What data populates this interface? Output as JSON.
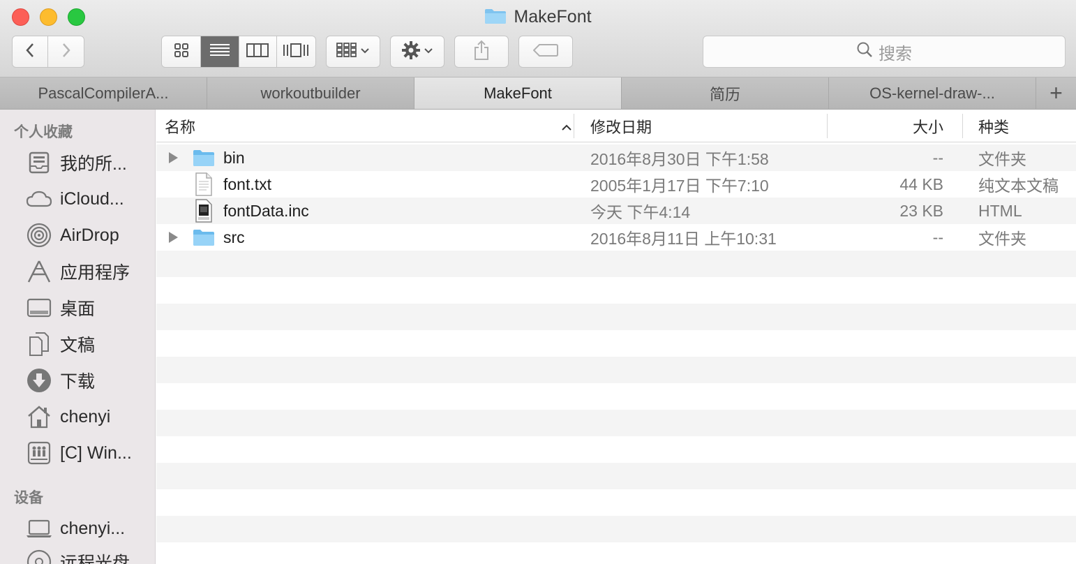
{
  "window": {
    "title": "MakeFont"
  },
  "toolbar": {
    "back_icon": "chevron-left-icon",
    "forward_icon": "chevron-right-icon",
    "view_modes": [
      "icon-view",
      "list-view",
      "column-view",
      "cover-flow-view"
    ],
    "active_view": "list-view",
    "search_placeholder": "搜索"
  },
  "tabs": [
    {
      "label": "PascalCompilerA..."
    },
    {
      "label": "workoutbuilder"
    },
    {
      "label": "MakeFont",
      "active": true
    },
    {
      "label": "简历"
    },
    {
      "label": "OS-kernel-draw-..."
    }
  ],
  "tab_add_label": "+",
  "sidebar": {
    "favorites_heading": "个人收藏",
    "favorites": [
      {
        "label": "我的所...",
        "icon": "all-files-icon"
      },
      {
        "label": "iCloud...",
        "icon": "cloud-icon"
      },
      {
        "label": "AirDrop",
        "icon": "airdrop-icon"
      },
      {
        "label": "应用程序",
        "icon": "applications-icon"
      },
      {
        "label": "桌面",
        "icon": "desktop-icon"
      },
      {
        "label": "文稿",
        "icon": "documents-icon"
      },
      {
        "label": "下载",
        "icon": "download-icon"
      },
      {
        "label": "chenyi",
        "icon": "home-icon"
      },
      {
        "label": "[C] Win...",
        "icon": "network-drive-icon"
      }
    ],
    "devices_heading": "设备",
    "devices": [
      {
        "label": "chenyi...",
        "icon": "laptop-icon"
      },
      {
        "label": "远程光盘",
        "icon": "disc-icon"
      }
    ]
  },
  "columns": {
    "name": "名称",
    "date": "修改日期",
    "size": "大小",
    "kind": "种类"
  },
  "files": [
    {
      "name": "bin",
      "date": "2016年8月30日 下午1:58",
      "size": "--",
      "kind": "文件夹",
      "type": "folder"
    },
    {
      "name": "font.txt",
      "date": "2005年1月17日 下午7:10",
      "size": "44 KB",
      "kind": "纯文本文稿",
      "type": "text"
    },
    {
      "name": "fontData.inc",
      "date": "今天 下午4:14",
      "size": "23 KB",
      "kind": "HTML",
      "type": "html"
    },
    {
      "name": "src",
      "date": "2016年8月11日 上午10:31",
      "size": "--",
      "kind": "文件夹",
      "type": "folder"
    }
  ]
}
